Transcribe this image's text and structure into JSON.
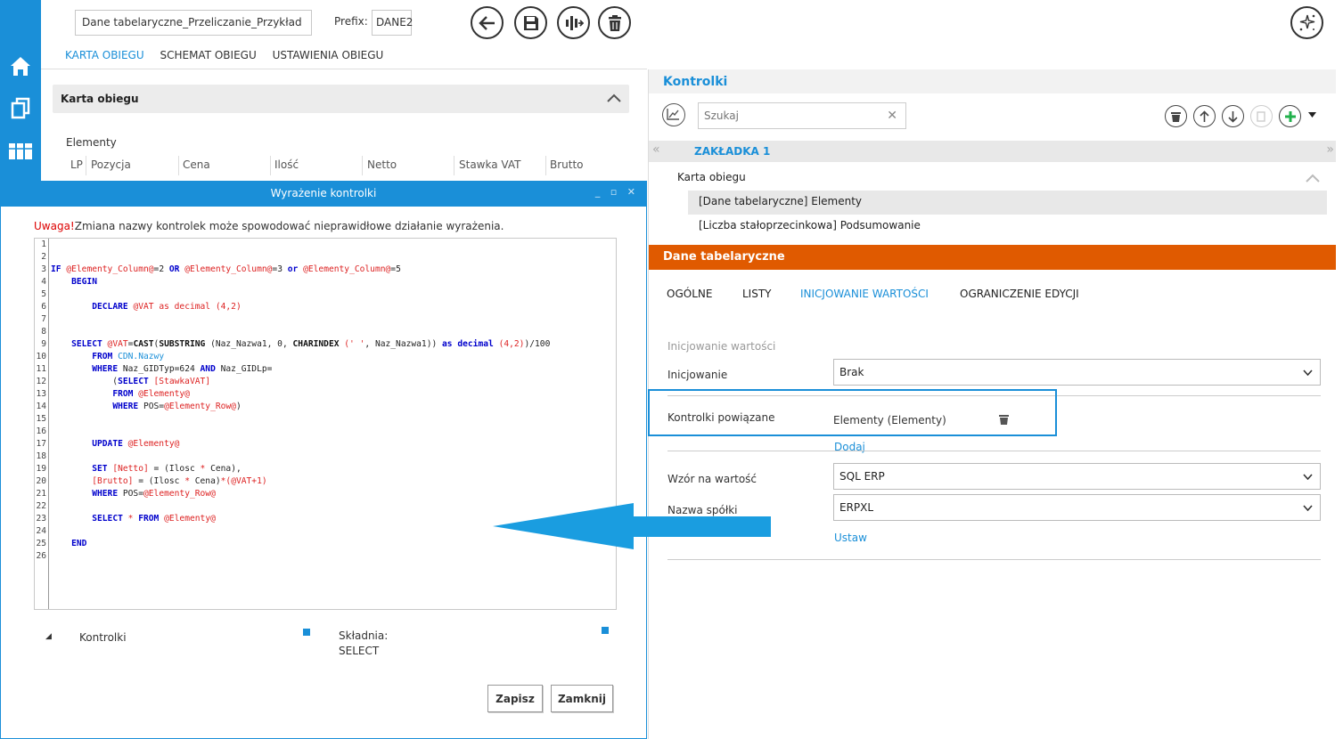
{
  "topbar": {
    "name_value": "Dane tabelaryczne_Przeliczanie_Przykład",
    "prefix_label": "Prefix:",
    "prefix_value": "DANE2"
  },
  "left_tabs": [
    "KARTA OBIEGU",
    "SCHEMAT OBIEGU",
    "USTAWIENIA OBIEGU"
  ],
  "karta": {
    "title": "Karta obiegu",
    "elements_label": "Elementy",
    "columns": [
      "LP",
      "Pozycja",
      "Cena",
      "Ilość",
      "Netto",
      "Stawka VAT",
      "Brutto"
    ]
  },
  "dialog": {
    "title": "Wyrażenie kontrolki",
    "warning_prefix": "Uwaga!",
    "warning_text": "Zmiana nazwy kontrolek może spowodować nieprawidłowe działanie wyrażenia.",
    "tree_label": "Kontrolki",
    "syntax_label": "Składnia:",
    "syntax_value": "SELECT",
    "save_label": "Zapisz",
    "close_label": "Zamknij"
  },
  "right": {
    "title": "Kontrolki",
    "search_placeholder": "Szukaj",
    "tab_label": "ZAKŁADKA 1",
    "tree_root": "Karta obiegu",
    "tree_items": [
      "[Dane tabelaryczne] Elementy",
      "[Liczba stałoprzecinkowa] Podsumowanie"
    ],
    "section_title": "Dane tabelaryczne",
    "sub_tabs": [
      "OGÓLNE",
      "LISTY",
      "INICJOWANIE WARTOŚCI",
      "OGRANICZENIE EDYCJI"
    ],
    "group_label": "Inicjowanie wartości",
    "init_label": "Inicjowanie",
    "init_value": "Brak",
    "related_label": "Kontrolki powiązane",
    "related_value": "Elementy (Elementy)",
    "add_link": "Dodaj",
    "formula_label": "Wzór na wartość",
    "formula_value": "SQL ERP",
    "company_label": "Nazwa spółki",
    "company_value": "ERPXL",
    "set_link": "Ustaw"
  },
  "colors": {
    "accent": "#1a8fd8",
    "orange": "#e05a00",
    "warning": "#dd0000"
  },
  "icons": [
    "home-icon",
    "copy-icon",
    "grid-icon",
    "back-icon",
    "save-icon",
    "flow-icon",
    "trash-icon",
    "wand-icon",
    "chart-icon",
    "up-icon",
    "down-icon",
    "add-icon"
  ]
}
